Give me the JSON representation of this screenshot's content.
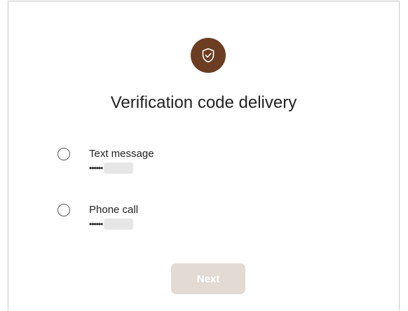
{
  "dialog": {
    "title": "Verification code delivery",
    "icon": "shield-check-icon",
    "accent_color": "#6b3d22"
  },
  "options": [
    {
      "label": "Text message",
      "masked_value": "••••••",
      "selected": false
    },
    {
      "label": "Phone call",
      "masked_value": "••••••",
      "selected": false
    }
  ],
  "actions": {
    "next_label": "Next",
    "next_enabled": false,
    "next_bg_color": "#e3dbd3"
  }
}
